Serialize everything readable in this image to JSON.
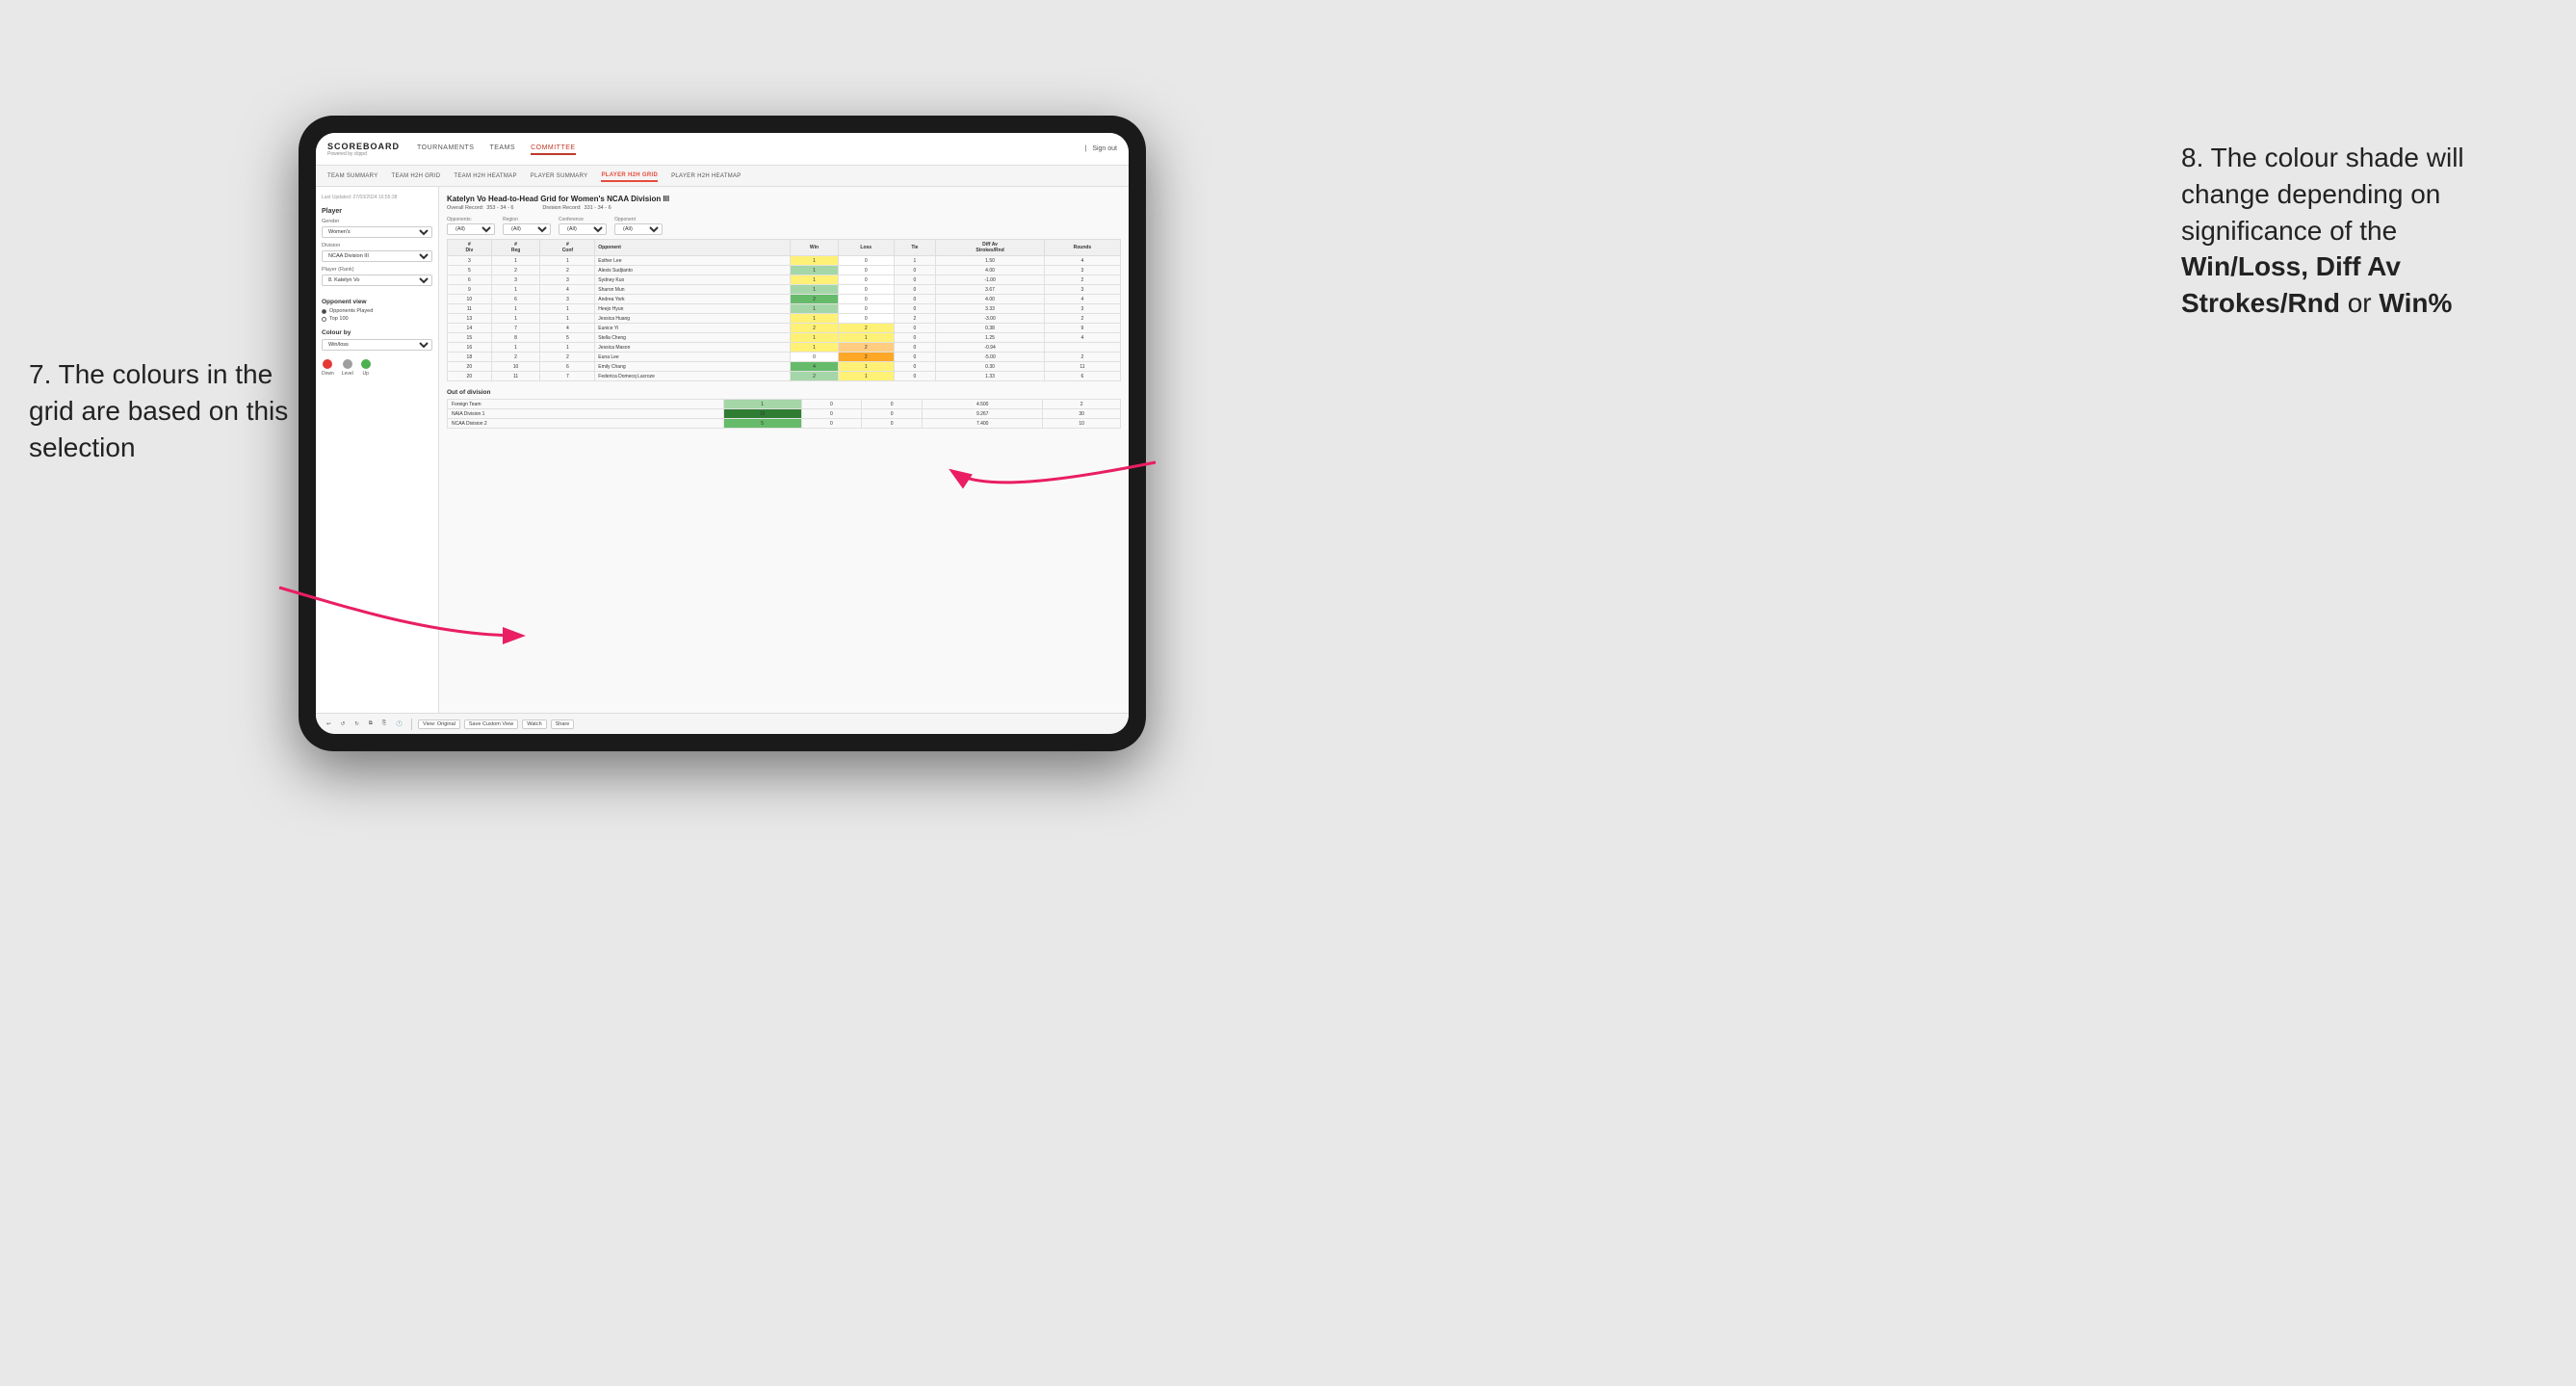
{
  "annotations": {
    "left_title": "7. The colours in the grid are based on this selection",
    "right_title": "8. The colour shade will change depending on significance of the",
    "right_bold1": "Win/Loss,",
    "right_bold2": "Diff Av Strokes/Rnd",
    "right_text2": "or",
    "right_bold3": "Win%"
  },
  "nav": {
    "logo": "SCOREBOARD",
    "logo_sub": "Powered by clippd",
    "items": [
      "TOURNAMENTS",
      "TEAMS",
      "COMMITTEE"
    ],
    "active": "COMMITTEE",
    "sign_out": "Sign out"
  },
  "sub_nav": {
    "items": [
      "TEAM SUMMARY",
      "TEAM H2H GRID",
      "TEAM H2H HEATMAP",
      "PLAYER SUMMARY",
      "PLAYER H2H GRID",
      "PLAYER H2H HEATMAP"
    ],
    "active": "PLAYER H2H GRID"
  },
  "left_panel": {
    "timestamp": "Last Updated: 27/03/2024 16:55:38",
    "section_player": "Player",
    "gender_label": "Gender",
    "gender_value": "Women's",
    "division_label": "Division",
    "division_value": "NCAA Division III",
    "player_rank_label": "Player (Rank)",
    "player_rank_value": "8. Katelyn Vo",
    "opponent_view": "Opponent view",
    "radio_opponents": "Opponents Played",
    "radio_top100": "Top 100",
    "colour_by": "Colour by",
    "colour_by_value": "Win/loss",
    "legend_down": "Down",
    "legend_level": "Level",
    "legend_up": "Up"
  },
  "grid": {
    "title": "Katelyn Vo Head-to-Head Grid for Women's NCAA Division III",
    "overall_record_label": "Overall Record:",
    "overall_record": "353 - 34 - 6",
    "division_record_label": "Division Record:",
    "division_record": "331 - 34 - 6",
    "filter_opponents_label": "Opponents:",
    "filter_opponents_value": "(All)",
    "filter_region_label": "Region",
    "filter_region_value": "(All)",
    "filter_conference_label": "Conference",
    "filter_conference_value": "(All)",
    "filter_opponent_label": "Opponent",
    "filter_opponent_value": "(All)",
    "col_headers": [
      "#\nDiv",
      "#\nReg",
      "#\nConf",
      "Opponent",
      "Win",
      "Loss",
      "Tie",
      "Diff Av\nStrokes/Rnd",
      "Rounds"
    ],
    "rows": [
      {
        "div": "3",
        "reg": "1",
        "conf": "1",
        "opponent": "Esther Lee",
        "win": "1",
        "loss": "0",
        "tie": "1",
        "diff": "1.50",
        "rounds": "4",
        "win_class": "c-yellow",
        "loss_class": "c-white"
      },
      {
        "div": "5",
        "reg": "2",
        "conf": "2",
        "opponent": "Alexis Sudjianto",
        "win": "1",
        "loss": "0",
        "tie": "0",
        "diff": "4.00",
        "rounds": "3",
        "win_class": "c-green1",
        "loss_class": "c-white"
      },
      {
        "div": "6",
        "reg": "3",
        "conf": "3",
        "opponent": "Sydney Kuo",
        "win": "1",
        "loss": "0",
        "tie": "0",
        "diff": "-1.00",
        "rounds": "2",
        "win_class": "c-yellow",
        "loss_class": "c-white"
      },
      {
        "div": "9",
        "reg": "1",
        "conf": "4",
        "opponent": "Sharon Mun",
        "win": "1",
        "loss": "0",
        "tie": "0",
        "diff": "3.67",
        "rounds": "3",
        "win_class": "c-green1",
        "loss_class": "c-white"
      },
      {
        "div": "10",
        "reg": "6",
        "conf": "3",
        "opponent": "Andrea York",
        "win": "2",
        "loss": "0",
        "tie": "0",
        "diff": "4.00",
        "rounds": "4",
        "win_class": "c-green2",
        "loss_class": "c-white"
      },
      {
        "div": "11",
        "reg": "1",
        "conf": "1",
        "opponent": "Heejo Hyun",
        "win": "1",
        "loss": "0",
        "tie": "0",
        "diff": "3.33",
        "rounds": "3",
        "win_class": "c-green1",
        "loss_class": "c-white"
      },
      {
        "div": "13",
        "reg": "1",
        "conf": "1",
        "opponent": "Jessica Huang",
        "win": "1",
        "loss": "0",
        "tie": "2",
        "diff": "-3.00",
        "rounds": "2",
        "win_class": "c-yellow",
        "loss_class": "c-white"
      },
      {
        "div": "14",
        "reg": "7",
        "conf": "4",
        "opponent": "Eunice Yi",
        "win": "2",
        "loss": "2",
        "tie": "0",
        "diff": "0.38",
        "rounds": "9",
        "win_class": "c-yellow",
        "loss_class": "c-yellow"
      },
      {
        "div": "15",
        "reg": "8",
        "conf": "5",
        "opponent": "Stella Cheng",
        "win": "1",
        "loss": "1",
        "tie": "0",
        "diff": "1.25",
        "rounds": "4",
        "win_class": "c-yellow",
        "loss_class": "c-yellow"
      },
      {
        "div": "16",
        "reg": "1",
        "conf": "1",
        "opponent": "Jessica Mason",
        "win": "1",
        "loss": "2",
        "tie": "0",
        "diff": "-0.94",
        "rounds": "",
        "win_class": "c-yellow",
        "loss_class": "c-orange1"
      },
      {
        "div": "18",
        "reg": "2",
        "conf": "2",
        "opponent": "Euna Lee",
        "win": "0",
        "loss": "2",
        "tie": "0",
        "diff": "-5.00",
        "rounds": "2",
        "win_class": "c-white",
        "loss_class": "c-orange2"
      },
      {
        "div": "20",
        "reg": "10",
        "conf": "6",
        "opponent": "Emily Chang",
        "win": "4",
        "loss": "1",
        "tie": "0",
        "diff": "0.30",
        "rounds": "11",
        "win_class": "c-green2",
        "loss_class": "c-yellow"
      },
      {
        "div": "20",
        "reg": "11",
        "conf": "7",
        "opponent": "Federica Domecq Lacroze",
        "win": "2",
        "loss": "1",
        "tie": "0",
        "diff": "1.33",
        "rounds": "6",
        "win_class": "c-green1",
        "loss_class": "c-yellow"
      }
    ],
    "out_of_division_title": "Out of division",
    "out_of_division_rows": [
      {
        "label": "Foreign Team",
        "win": "1",
        "loss": "0",
        "tie": "0",
        "diff": "4.500",
        "rounds": "2",
        "win_class": "c-green1"
      },
      {
        "label": "NAIA Division 1",
        "win": "15",
        "loss": "0",
        "tie": "0",
        "diff": "9.267",
        "rounds": "30",
        "win_class": "c-green3"
      },
      {
        "label": "NCAA Division 2",
        "win": "5",
        "loss": "0",
        "tie": "0",
        "diff": "7.400",
        "rounds": "10",
        "win_class": "c-green2"
      }
    ]
  },
  "toolbar": {
    "view_original": "View: Original",
    "save_custom": "Save Custom View",
    "watch": "Watch",
    "share": "Share"
  }
}
